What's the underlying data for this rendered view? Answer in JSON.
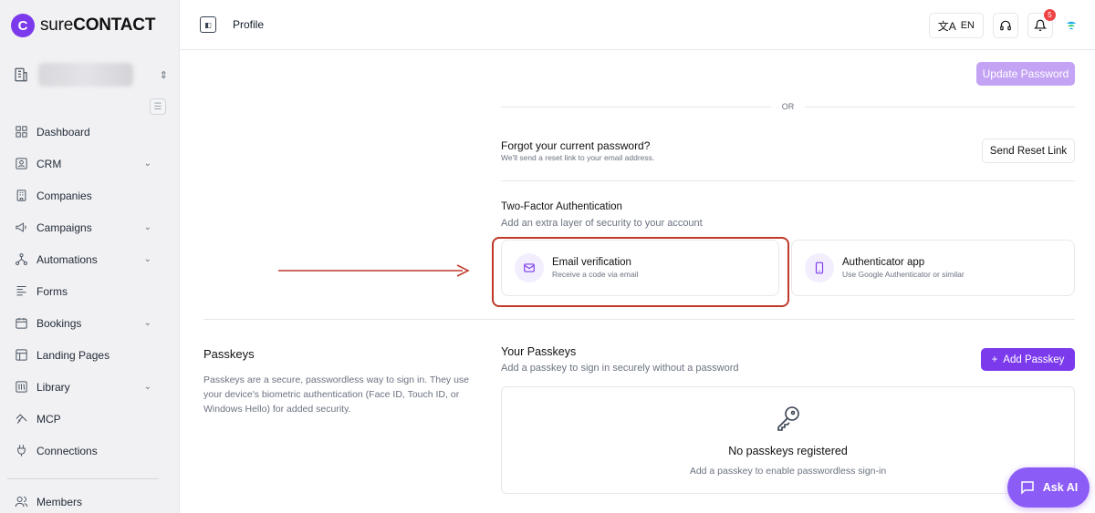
{
  "brand": {
    "prefix": "sure",
    "suffix": "CONTACT",
    "mark": "C"
  },
  "sidebar": {
    "items": [
      {
        "label": "Dashboard",
        "icon": "dashboard-icon",
        "chevron": false
      },
      {
        "label": "CRM",
        "icon": "contact-card-icon",
        "chevron": true
      },
      {
        "label": "Companies",
        "icon": "building-icon",
        "chevron": false
      },
      {
        "label": "Campaigns",
        "icon": "megaphone-icon",
        "chevron": true
      },
      {
        "label": "Automations",
        "icon": "workflow-icon",
        "chevron": true
      },
      {
        "label": "Forms",
        "icon": "form-icon",
        "chevron": false
      },
      {
        "label": "Bookings",
        "icon": "calendar-icon",
        "chevron": true
      },
      {
        "label": "Landing Pages",
        "icon": "layout-icon",
        "chevron": false
      },
      {
        "label": "Library",
        "icon": "library-icon",
        "chevron": true
      },
      {
        "label": "MCP",
        "icon": "mcp-icon",
        "chevron": false
      },
      {
        "label": "Connections",
        "icon": "plug-icon",
        "chevron": false
      }
    ],
    "members": "Members"
  },
  "topbar": {
    "title": "Profile",
    "language": "EN",
    "notifications": "5"
  },
  "password": {
    "update_label": "Update Password",
    "or_label": "OR",
    "forgot_title": "Forgot your current password?",
    "forgot_sub": "We'll send a reset link to your email address.",
    "reset_label": "Send Reset Link"
  },
  "two_factor": {
    "title": "Two-Factor Authentication",
    "subtitle": "Add an extra layer of security to your account",
    "options": [
      {
        "title": "Email verification",
        "subtitle": "Receive a code via email",
        "icon": "mail-icon"
      },
      {
        "title": "Authenticator app",
        "subtitle": "Use Google Authenticator or similar",
        "icon": "phone-icon"
      }
    ]
  },
  "passkeys": {
    "title": "Passkeys",
    "description": "Passkeys are a secure, passwordless way to sign in. They use your device's biometric authentication (Face ID, Touch ID, or Windows Hello) for added security.",
    "your_title": "Your Passkeys",
    "your_sub": "Add a passkey to sign in securely without a password",
    "add_label": "Add Passkey",
    "empty_title": "No passkeys registered",
    "empty_sub": "Add a passkey to enable passwordless sign-in"
  },
  "ask_ai": "Ask AI",
  "colors": {
    "accent": "#7c3aed",
    "accent_light": "#c4a3f5",
    "annotation": "#c0392b"
  }
}
